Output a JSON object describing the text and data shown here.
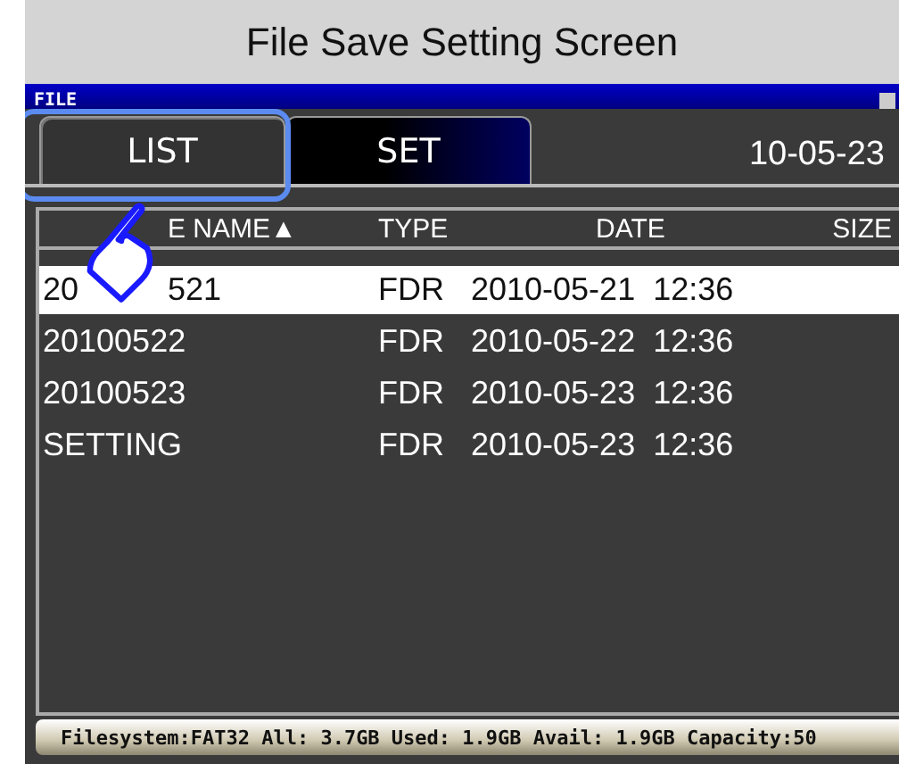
{
  "caption": "File Save Setting Screen",
  "screen": {
    "title": "FILE",
    "tabs": [
      {
        "label": "LIST",
        "selected": true
      },
      {
        "label": "SET",
        "selected": false
      }
    ],
    "date": "10-05-23"
  },
  "table": {
    "columns": [
      "E NAME▲",
      "TYPE",
      "DATE",
      "SIZE"
    ],
    "rows": [
      {
        "name": "20",
        "name_after": "521",
        "type": "FDR",
        "date": "2010-05-21  12:36",
        "selected": true
      },
      {
        "name": "20100522",
        "type": "FDR",
        "date": "2010-05-22  12:36",
        "selected": false
      },
      {
        "name": "20100523",
        "type": "FDR",
        "date": "2010-05-23  12:36",
        "selected": false
      },
      {
        "name": "SETTING",
        "type": "FDR",
        "date": "2010-05-23  12:36",
        "selected": false
      }
    ]
  },
  "status_bar": "Filesystem:FAT32 All: 3.7GB Used: 1.9GB Avail: 1.9GB Capacity:50"
}
